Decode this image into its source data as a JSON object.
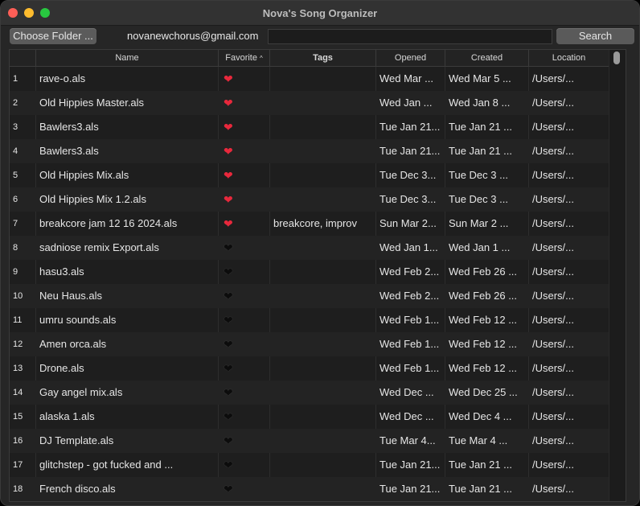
{
  "window": {
    "title": "Nova's Song Organizer"
  },
  "toolbar": {
    "choose_label": "Choose Folder ...",
    "email": "novanewchorus@gmail.com",
    "search_value": "",
    "search_label": "Search"
  },
  "table": {
    "columns": {
      "name": "Name",
      "favorite": "Favorite",
      "tags": "Tags",
      "opened": "Opened",
      "created": "Created",
      "location": "Location"
    },
    "sort_indicator": "^",
    "rows": [
      {
        "num": "1",
        "name": "rave-o.als",
        "favorite": true,
        "tags": "",
        "opened": "Wed Mar  ...",
        "created": "Wed Mar  5 ...",
        "location": "/Users/..."
      },
      {
        "num": "2",
        "name": "Old Hippies Master.als",
        "favorite": true,
        "tags": "",
        "opened": "Wed Jan  ...",
        "created": "Wed Jan  8 ...",
        "location": "/Users/..."
      },
      {
        "num": "3",
        "name": "Bawlers3.als",
        "favorite": true,
        "tags": "",
        "opened": "Tue Jan 21...",
        "created": "Tue Jan 21 ...",
        "location": "/Users/..."
      },
      {
        "num": "4",
        "name": "Bawlers3.als",
        "favorite": true,
        "tags": "",
        "opened": "Tue Jan 21...",
        "created": "Tue Jan 21 ...",
        "location": "/Users/..."
      },
      {
        "num": "5",
        "name": "Old Hippies Mix.als",
        "favorite": true,
        "tags": "",
        "opened": "Tue Dec  3...",
        "created": "Tue Dec  3 ...",
        "location": "/Users/..."
      },
      {
        "num": "6",
        "name": "Old Hippies Mix 1.2.als",
        "favorite": true,
        "tags": "",
        "opened": "Tue Dec  3...",
        "created": "Tue Dec  3 ...",
        "location": "/Users/..."
      },
      {
        "num": "7",
        "name": "breakcore jam 12 16 2024.als",
        "favorite": true,
        "tags": "breakcore, improv",
        "opened": "Sun Mar  2...",
        "created": "Sun Mar  2 ...",
        "location": "/Users/..."
      },
      {
        "num": "8",
        "name": "sadniose remix Export.als",
        "favorite": false,
        "tags": "",
        "opened": "Wed Jan  1...",
        "created": "Wed Jan  1 ...",
        "location": "/Users/..."
      },
      {
        "num": "9",
        "name": "hasu3.als",
        "favorite": false,
        "tags": "",
        "opened": "Wed Feb 2...",
        "created": "Wed Feb 26 ...",
        "location": "/Users/..."
      },
      {
        "num": "10",
        "name": "Neu Haus.als",
        "favorite": false,
        "tags": "",
        "opened": "Wed Feb 2...",
        "created": "Wed Feb 26 ...",
        "location": "/Users/..."
      },
      {
        "num": "11",
        "name": "umru sounds.als",
        "favorite": false,
        "tags": "",
        "opened": "Wed Feb 1...",
        "created": "Wed Feb 12 ...",
        "location": "/Users/..."
      },
      {
        "num": "12",
        "name": "Amen orca.als",
        "favorite": false,
        "tags": "",
        "opened": "Wed Feb 1...",
        "created": "Wed Feb 12 ...",
        "location": "/Users/..."
      },
      {
        "num": "13",
        "name": "Drone.als",
        "favorite": false,
        "tags": "",
        "opened": "Wed Feb 1...",
        "created": "Wed Feb 12 ...",
        "location": "/Users/..."
      },
      {
        "num": "14",
        "name": "Gay angel mix.als",
        "favorite": false,
        "tags": "",
        "opened": "Wed Dec  ...",
        "created": "Wed Dec 25 ...",
        "location": "/Users/..."
      },
      {
        "num": "15",
        "name": "alaska 1.als",
        "favorite": false,
        "tags": "",
        "opened": "Wed Dec  ...",
        "created": "Wed Dec  4 ...",
        "location": "/Users/..."
      },
      {
        "num": "16",
        "name": "DJ Template.als",
        "favorite": false,
        "tags": "",
        "opened": "Tue Mar  4...",
        "created": "Tue Mar  4 ...",
        "location": "/Users/..."
      },
      {
        "num": "17",
        "name": "glitchstep - got fucked and ...",
        "favorite": false,
        "tags": "",
        "opened": "Tue Jan 21...",
        "created": "Tue Jan 21 ...",
        "location": "/Users/..."
      },
      {
        "num": "18",
        "name": "French disco.als",
        "favorite": false,
        "tags": "",
        "opened": "Tue Jan 21...",
        "created": "Tue Jan 21 ...",
        "location": "/Users/..."
      }
    ]
  },
  "colors": {
    "favorite_on": "#e8283c",
    "favorite_off": "#0c0c0c"
  },
  "icons": {
    "favorite_on": "red-heart-icon",
    "favorite_off": "black-heart-icon"
  }
}
